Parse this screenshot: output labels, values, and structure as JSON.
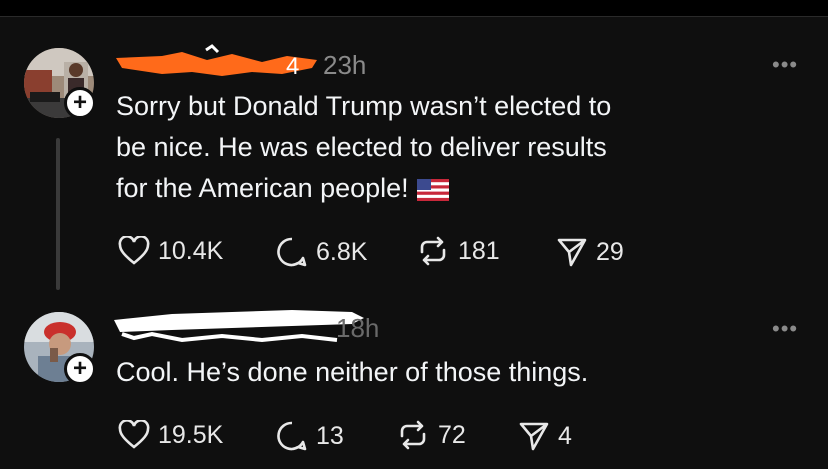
{
  "posts": [
    {
      "time": "23h",
      "text_lines": [
        "Sorry but Donald Trump wasn’t elected to",
        "be nice. He was elected to deliver results",
        "for the American people!"
      ],
      "flag_icon": "us-flag-emoji",
      "likes": "10.4K",
      "replies": "6.8K",
      "reposts": "181",
      "shares": "29"
    },
    {
      "time": "18h",
      "text": "Cool. He’s done neither of those things.",
      "likes": "19.5K",
      "replies": "13",
      "reposts": "72",
      "shares": "4"
    }
  ],
  "more_label": "•••",
  "follow_label": "+",
  "colors": {
    "background": "#0f0f0f",
    "text": "#f3f5f7",
    "muted": "#8a8a8a",
    "redaction_orange": "#ff6a1a",
    "redaction_white": "#ffffff"
  },
  "icons": {
    "like": "heart-icon",
    "reply": "comment-icon",
    "repost": "repost-icon",
    "share": "send-icon",
    "more": "ellipsis-icon"
  }
}
